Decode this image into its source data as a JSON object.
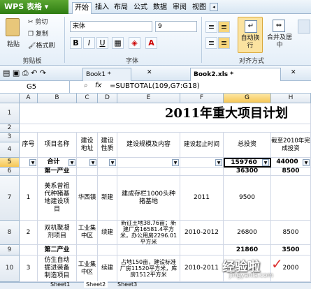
{
  "app": {
    "name": "WPS 表格"
  },
  "menu_tabs": [
    "开始",
    "插入",
    "布局",
    "公式",
    "数据",
    "审阅",
    "视图"
  ],
  "clipboard": {
    "paste": "粘贴",
    "cut": "剪切",
    "copy": "复制",
    "format_painter": "格式刷",
    "group": "剪贴板"
  },
  "font": {
    "name": "宋体",
    "size": "9",
    "bold": "B",
    "italic": "I",
    "underline": "U",
    "group": "字体"
  },
  "align": {
    "wrap": "自动换行",
    "merge": "合并及居中",
    "group": "对齐方式"
  },
  "doc_tabs": [
    "Book1 *",
    "Book2.xls *"
  ],
  "formula_bar": {
    "cell_ref": "G5",
    "fx": "fx",
    "formula": "=SUBTOTAL(109,G7:G18)"
  },
  "columns": [
    "A",
    "B",
    "C",
    "D",
    "E",
    "F",
    "G",
    "H"
  ],
  "rows": [
    "1",
    "2",
    "3",
    "4",
    "5",
    "6",
    "7",
    "8",
    "9",
    "10"
  ],
  "sheet": {
    "title": "2011年重大项目计划",
    "headers": [
      "序号",
      "项目名称",
      "建设地址",
      "建设性质",
      "建设规模及内容",
      "建设起止时间",
      "总投资",
      "截至2010年完成投资"
    ],
    "subtotal": {
      "label": "合计",
      "total": "159760",
      "done": "44000"
    },
    "row6": {
      "label": "第一产业",
      "total": "36300",
      "done": "8500"
    },
    "row7": {
      "no": "1",
      "name": "美系曾祖代种猪基地建设项目",
      "addr": "华西镇",
      "nature": "新建",
      "scale": "建成存栏1000头种猪基地",
      "time": "2011",
      "total": "9500"
    },
    "row8": {
      "no": "2",
      "name": "双机聚凝剂项目",
      "addr": "工业集中区",
      "nature": "续建",
      "scale": "新征土地38.76亩；新建厂房16581.4平方米，办公用房2296.01平方米",
      "time": "2010-2012",
      "total": "26800",
      "done": "8500"
    },
    "row9": {
      "label": "第二产业",
      "total": "21860",
      "done": "3500"
    },
    "row10": {
      "no": "3",
      "name": "仿生自动掘进装备制造项目",
      "addr": "工业集中区",
      "nature": "续建",
      "scale": "占地150亩，建设标准厂房11520平方米，库房1512平方米",
      "time": "2010-2011",
      "total": "16860",
      "done": "2000"
    }
  },
  "sheet_tabs": [
    "Sheet1",
    "Sheet2",
    "Sheet3"
  ],
  "watermark": {
    "text": "经验啦",
    "url": "jingyanla.com"
  }
}
